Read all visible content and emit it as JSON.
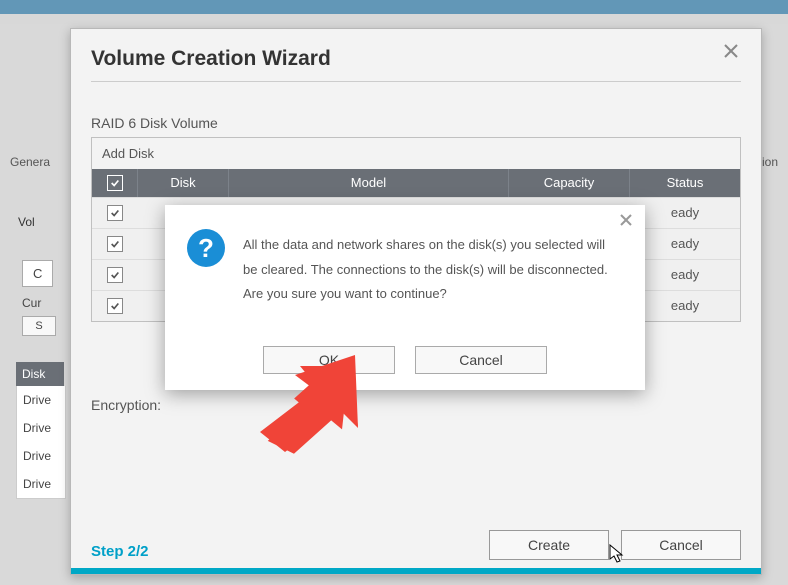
{
  "bg": {
    "left_label": "Genera",
    "right_label": "ation",
    "vol": "Vol",
    "cu_btn": "C",
    "cur": "Cur",
    "s_btn": "S",
    "disk_head": "Disk",
    "drive": "Drive"
  },
  "wizard": {
    "title": "Volume Creation Wizard",
    "subtitle": "RAID 6 Disk Volume",
    "add_disk": "Add Disk",
    "columns": {
      "disk": "Disk",
      "model": "Model",
      "capacity": "Capacity",
      "status": "Status"
    },
    "rows": [
      {
        "status": "eady"
      },
      {
        "status": "eady"
      },
      {
        "status": "eady"
      },
      {
        "status": "eady"
      }
    ],
    "encryption_label": "Encryption:",
    "step": "Step 2/2",
    "create": "Create",
    "cancel": "Cancel"
  },
  "confirm": {
    "message": "All the data and network shares on the disk(s) you selected will be cleared. The connections to the disk(s) will be disconnected. Are you sure you want to continue?",
    "ok": "OK",
    "cancel": "Cancel"
  }
}
